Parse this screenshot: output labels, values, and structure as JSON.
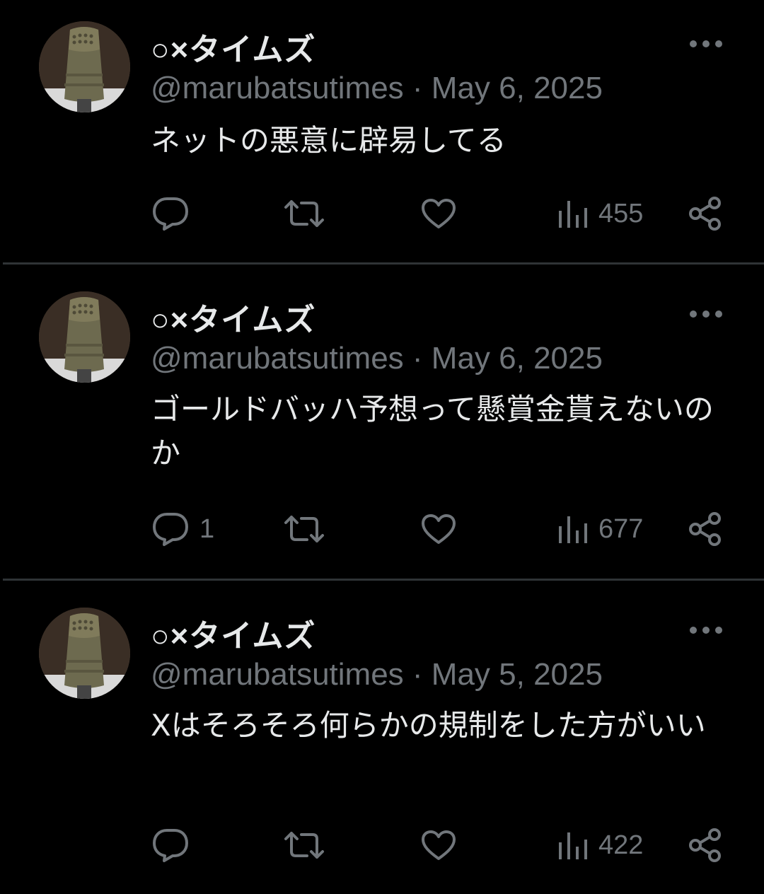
{
  "tweets": [
    {
      "name": "○×タイムズ",
      "handle": "@marubatsutimes",
      "separator": "·",
      "date": "May 6, 2025",
      "text": "ネットの悪意に辟易してる",
      "replies": "",
      "views": "455"
    },
    {
      "name": "○×タイムズ",
      "handle": "@marubatsutimes",
      "separator": "·",
      "date": "May 6, 2025",
      "text": "ゴールドバッハ予想って懸賞金貰えないのか",
      "replies": "1",
      "views": "677"
    },
    {
      "name": "○×タイムズ",
      "handle": "@marubatsutimes",
      "separator": "·",
      "date": "May 5, 2025",
      "text": "Xはそろそろ何らかの規制をした方がいい",
      "replies": "",
      "views": "422"
    }
  ],
  "icons": {
    "avatar": "bronze-bell-avatar",
    "more": "more-dots-icon",
    "reply": "reply-bubble-icon",
    "retweet": "retweet-icon",
    "like": "heart-icon",
    "views": "views-bar-icon",
    "share": "share-icon"
  },
  "colors": {
    "background": "#000000",
    "primary_text": "#e7e9ea",
    "secondary_text": "#71767b",
    "divider": "#2f3336"
  }
}
